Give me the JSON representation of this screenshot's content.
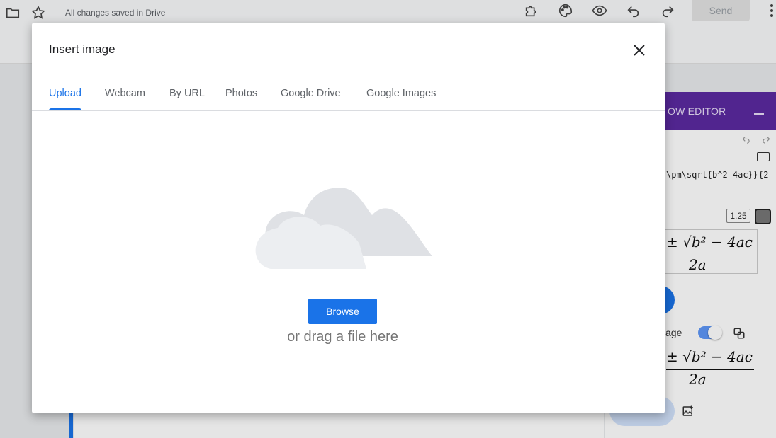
{
  "app": {
    "save_status": "All changes saved in Drive",
    "send_label": "Send"
  },
  "side_panel": {
    "header_title": "OW EDITOR",
    "latex_value": "\\pm\\sqrt{b^2-4ac}}{2",
    "scale_value": "1.25",
    "formula_numerator": "± √b² − 4ac",
    "formula_denominator": "2a",
    "image_label": "age",
    "accent_color": "#5b2aa0"
  },
  "dialog": {
    "title": "Insert image",
    "tabs": [
      {
        "label": "Upload",
        "active": true
      },
      {
        "label": "Webcam",
        "active": false
      },
      {
        "label": "By URL",
        "active": false
      },
      {
        "label": "Photos",
        "active": false
      },
      {
        "label": "Google Drive",
        "active": false
      },
      {
        "label": "Google Images",
        "active": false
      }
    ],
    "browse_label": "Browse",
    "drag_text": "or drag a file here",
    "accent_color": "#1a73e8"
  }
}
